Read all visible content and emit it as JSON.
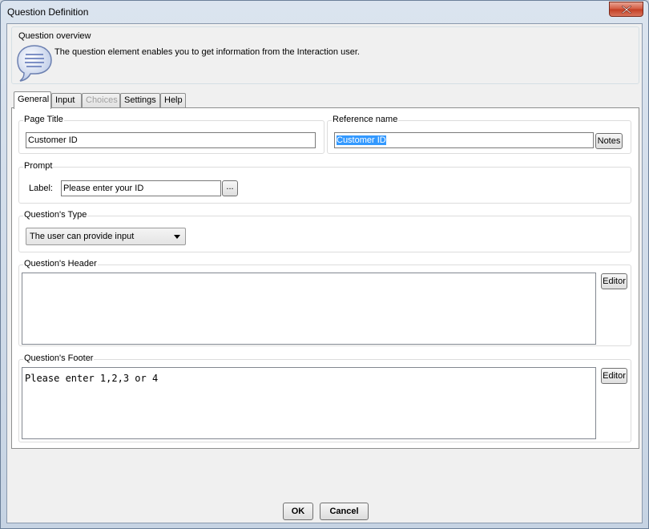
{
  "window": {
    "title": "Question Definition"
  },
  "overview": {
    "title": "Question overview",
    "text": "The question element enables you to get information from the Interaction user."
  },
  "tabs": [
    {
      "label": "General",
      "state": "active"
    },
    {
      "label": "Input",
      "state": "normal"
    },
    {
      "label": "Choices",
      "state": "disabled"
    },
    {
      "label": "Settings",
      "state": "normal"
    },
    {
      "label": "Help",
      "state": "normal"
    }
  ],
  "page_title": {
    "label": "Page Title",
    "value": "Customer ID"
  },
  "reference_name": {
    "label": "Reference name",
    "value": "Customer ID",
    "notes_label": "Notes"
  },
  "prompt": {
    "label": "Prompt",
    "field_label": "Label:",
    "value": "Please enter your ID",
    "browse_label": "..."
  },
  "question_type": {
    "label": "Question's Type",
    "selected": "The user can provide input"
  },
  "question_header": {
    "label": "Question's Header",
    "value": "",
    "editor_label": "Editor"
  },
  "question_footer": {
    "label": "Question's Footer",
    "value": "Please enter 1,2,3 or 4",
    "editor_label": "Editor"
  },
  "buttons": {
    "ok": "OK",
    "cancel": "Cancel"
  },
  "colors": {
    "selection": "#3399ff",
    "close_button": "#c23d22"
  }
}
